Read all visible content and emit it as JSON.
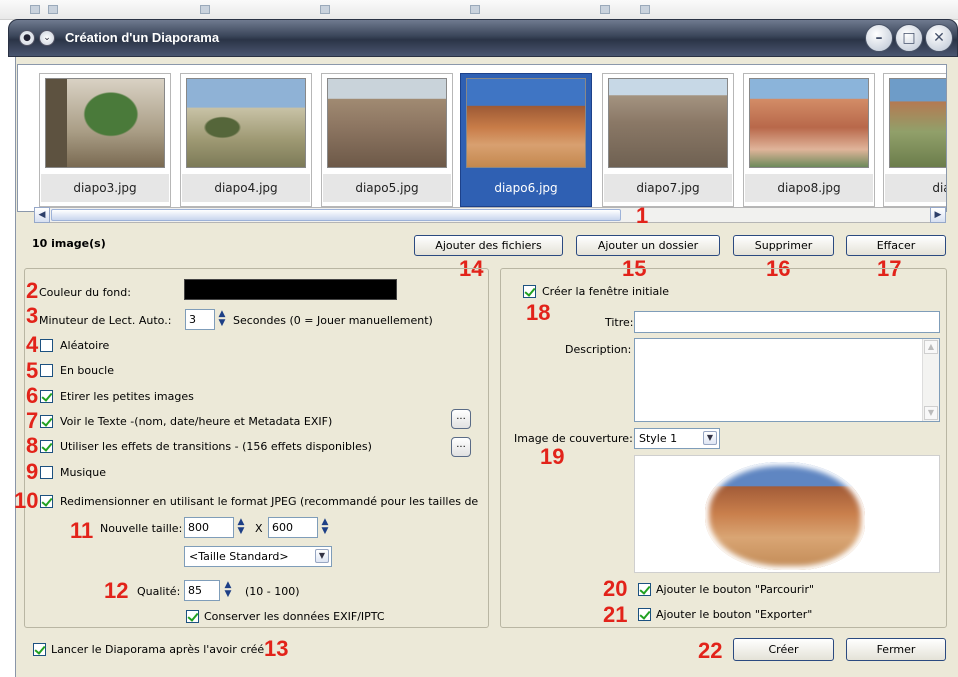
{
  "window": {
    "title": "Création d'un Diaporama"
  },
  "thumbnails": [
    {
      "label": "diapo3.jpg",
      "selected": false
    },
    {
      "label": "diapo4.jpg",
      "selected": false
    },
    {
      "label": "diapo5.jpg",
      "selected": false
    },
    {
      "label": "diapo6.jpg",
      "selected": true
    },
    {
      "label": "diapo7.jpg",
      "selected": false
    },
    {
      "label": "diapo8.jpg",
      "selected": false
    },
    {
      "label": "diapo",
      "selected": false
    }
  ],
  "image_count": "10 image(s)",
  "buttons": {
    "add_files": "Ajouter des fichiers",
    "add_folder": "Ajouter un dossier",
    "delete": "Supprimer",
    "clear": "Effacer",
    "create": "Créer",
    "close": "Fermer",
    "ellipsis": "..."
  },
  "callouts": [
    "1",
    "2",
    "3",
    "4",
    "5",
    "6",
    "7",
    "8",
    "9",
    "10",
    "11",
    "12",
    "13",
    "14",
    "15",
    "16",
    "17",
    "18",
    "19",
    "20",
    "21",
    "22"
  ],
  "left": {
    "bg_color_label": "Couleur du fond:",
    "bg_color": "#000000",
    "timer_label": "Minuteur de Lect. Auto.:",
    "timer_value": "3",
    "timer_unit": "Secondes (0 = Jouer  manuellement)",
    "random_label": "Aléatoire",
    "random_checked": false,
    "loop_label": "En boucle",
    "loop_checked": false,
    "stretch_label": "Etirer les petites images",
    "stretch_checked": true,
    "show_text_label": "Voir le Texte -(nom, date/heure et Metadata EXIF)",
    "show_text_checked": true,
    "transitions_label": "Utiliser les effets de transitions  -  (156 effets disponibles)",
    "transitions_checked": true,
    "music_label": "Musique",
    "music_checked": false,
    "resize_label": "Redimensionner en utilisant le format JPEG (recommandé pour les tailles de",
    "resize_checked": true,
    "new_size_label": "Nouvelle taille:",
    "width": "800",
    "x_sep": "X",
    "height": "600",
    "size_preset": "<Taille Standard>",
    "quality_label": "Qualité:",
    "quality": "85",
    "quality_range": "(10 - 100)",
    "keep_exif_label": "Conserver les données EXIF/IPTC",
    "keep_exif_checked": true
  },
  "right": {
    "create_window_label": "Créer la fenêtre initiale",
    "create_window_checked": true,
    "title_label": "Titre:",
    "title_value": "",
    "desc_label": "Description:",
    "desc_value": "",
    "cover_label": "Image de couverture:",
    "cover_style": "Style 1",
    "browse_label": "Ajouter le bouton \"Parcourir\"",
    "browse_checked": true,
    "export_label": "Ajouter le bouton \"Exporter\"",
    "export_checked": true
  },
  "bottom": {
    "launch_label": "Lancer le Diaporama après l'avoir créé",
    "launch_checked": true
  }
}
